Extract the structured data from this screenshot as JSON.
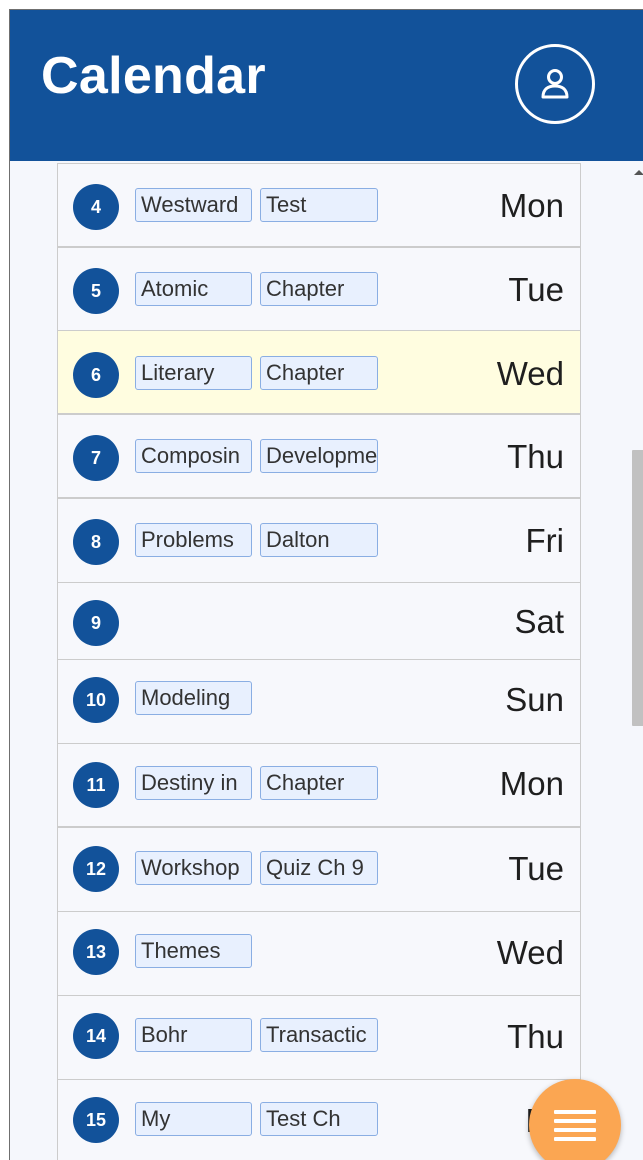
{
  "header": {
    "title": "Calendar",
    "profile_icon": "person-icon"
  },
  "days": [
    {
      "day": "4",
      "weekday": "Mon",
      "events": [
        "Westward",
        "Test"
      ]
    },
    {
      "day": "5",
      "weekday": "Tue",
      "events": [
        "Atomic",
        "Chapter"
      ]
    },
    {
      "day": "6",
      "weekday": "Wed",
      "events": [
        "Literary",
        "Chapter"
      ],
      "today": true
    },
    {
      "day": "7",
      "weekday": "Thu",
      "events": [
        "Composin",
        "Developme"
      ]
    },
    {
      "day": "8",
      "weekday": "Fri",
      "events": [
        "Problems",
        "Dalton"
      ]
    },
    {
      "day": "9",
      "weekday": "Sat",
      "events": []
    },
    {
      "day": "10",
      "weekday": "Sun",
      "events": [
        "Modeling"
      ]
    },
    {
      "day": "11",
      "weekday": "Mon",
      "events": [
        "Destiny in",
        "Chapter"
      ]
    },
    {
      "day": "12",
      "weekday": "Tue",
      "events": [
        "Workshop",
        "Quiz Ch 9"
      ]
    },
    {
      "day": "13",
      "weekday": "Wed",
      "events": [
        "Themes"
      ]
    },
    {
      "day": "14",
      "weekday": "Thu",
      "events": [
        "Bohr",
        "Transactic"
      ]
    },
    {
      "day": "15",
      "weekday": "Fri",
      "events": [
        "My",
        "Test Ch"
      ]
    }
  ],
  "colors": {
    "header": "#12529a",
    "today_row": "#fffde0",
    "chip_bg": "#e8f0fe",
    "chip_border": "#8aaee3",
    "fab": "#fba652"
  },
  "fab": {
    "icon": "menu-icon"
  }
}
